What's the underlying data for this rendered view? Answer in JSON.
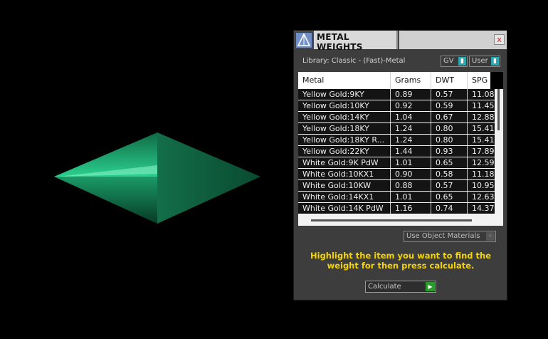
{
  "window": {
    "title": "METAL WEIGHTS",
    "close_glyph": "x",
    "logo_icon": "app-logo-icon"
  },
  "library": {
    "label": "Library: Classic - (Fast)-Metal",
    "units_dropdown": "GV",
    "user_dropdown": "User"
  },
  "table": {
    "columns": [
      "Metal",
      "Grams",
      "DWT",
      "SPG"
    ],
    "rows": [
      [
        "Yellow Gold:9KY",
        "0.89",
        "0.57",
        "11.08"
      ],
      [
        "Yellow Gold:10KY",
        "0.92",
        "0.59",
        "11.45"
      ],
      [
        "Yellow Gold:14KY",
        "1.04",
        "0.67",
        "12.88"
      ],
      [
        "Yellow Gold:18KY",
        "1.24",
        "0.80",
        "15.41"
      ],
      [
        "Yellow Gold:18KY R...",
        "1.24",
        "0.80",
        "15.41"
      ],
      [
        "Yellow Gold:22KY",
        "1.44",
        "0.93",
        "17.89"
      ],
      [
        "White Gold:9K PdW",
        "1.01",
        "0.65",
        "12.59"
      ],
      [
        "White Gold:10KX1",
        "0.90",
        "0.58",
        "11.18"
      ],
      [
        "White Gold:10KW",
        "0.88",
        "0.57",
        "10.95"
      ],
      [
        "White Gold:14KX1",
        "1.01",
        "0.65",
        "12.63"
      ],
      [
        "White Gold:14K PdW",
        "1.16",
        "0.74",
        "14.37"
      ]
    ]
  },
  "materials_dropdown": "Use Object Materials",
  "instruction": "Highlight the item you want to find the weight for then press calculate.",
  "calculate_button": "Calculate",
  "colors": {
    "gem": "#1a8a5e",
    "instruction": "#f5d400",
    "accent_teal": "#2aa8b0",
    "accent_green": "#2b9b2b"
  }
}
